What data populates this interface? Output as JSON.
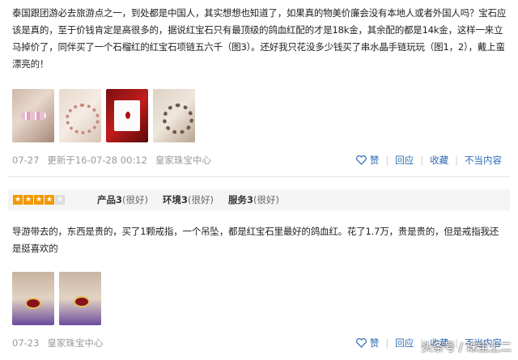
{
  "review1": {
    "text": "泰国跟团游必去旅游点之一，到处都是中国人，其实想想也知道了，如果真的物美价廉会没有本地人或者外国人吗？宝石应该是真的，至于价钱肯定是高很多的，据说红宝石只有最顶级的鸽血红配的才是18k金，其余配的都是14k金，这样一来立马掉价了，同伴买了一个石榴红的红宝石项链五六千（图3）。还好我只花没多少钱买了串水晶手链玩玩（图1，2），戴上蛮漂亮的！",
    "date": "07-27",
    "updated": "更新于16-07-28 00:12",
    "shop": "皇家珠宝中心",
    "photo_count": 4
  },
  "review2": {
    "stars": 4,
    "scores": [
      {
        "label": "产品3",
        "note": "(很好)"
      },
      {
        "label": "环境3",
        "note": "(很好)"
      },
      {
        "label": "服务3",
        "note": "(很好)"
      }
    ],
    "text": "导游带去的，东西是贵的，买了1颗戒指，一个吊坠，都是红宝石里最好的鸽血红。花了1.7万，贵是贵的，但是戒指我还是挺喜欢的",
    "date": "07-23",
    "shop": "皇家珠宝中心",
    "photo_count": 2
  },
  "actions": {
    "like": "赞",
    "reply": "回应",
    "collect": "收藏",
    "report": "不当内容"
  },
  "watermark": "头条号 / 珠宝上二",
  "colors": {
    "link": "#2d6db5",
    "star": "#f39800",
    "meta": "#999999"
  }
}
